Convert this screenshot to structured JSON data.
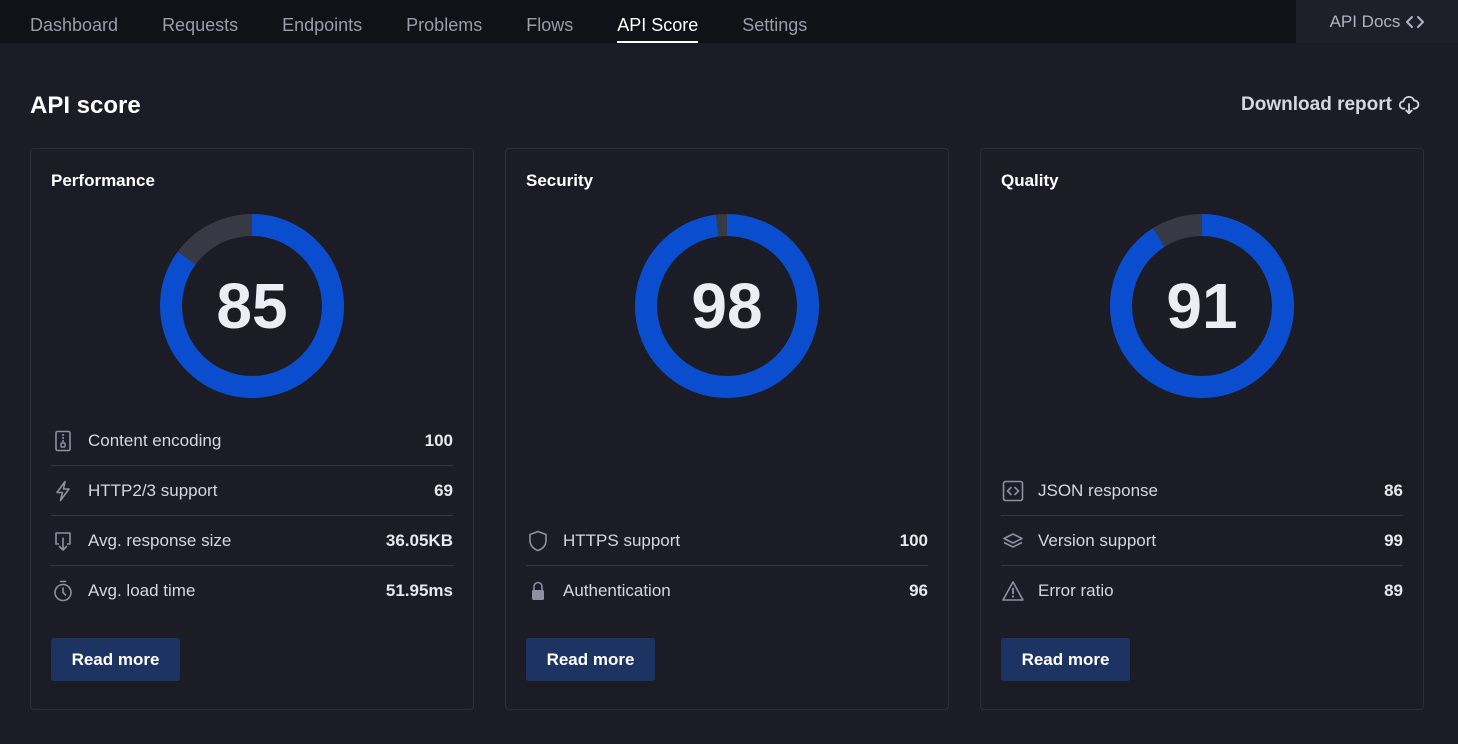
{
  "nav": {
    "tabs": [
      {
        "label": "Dashboard",
        "active": false
      },
      {
        "label": "Requests",
        "active": false
      },
      {
        "label": "Endpoints",
        "active": false
      },
      {
        "label": "Problems",
        "active": false
      },
      {
        "label": "Flows",
        "active": false
      },
      {
        "label": "API Score",
        "active": true
      },
      {
        "label": "Settings",
        "active": false
      }
    ],
    "api_docs_label": "API Docs"
  },
  "header": {
    "title": "API score",
    "download_label": "Download report"
  },
  "colors": {
    "gauge_fill": "#0a4ecf",
    "gauge_track": "#373945",
    "button": "#1d3462"
  },
  "cards": [
    {
      "title": "Performance",
      "score": 85,
      "score_text": "85",
      "metrics": [
        {
          "icon": "zip-file-icon",
          "label": "Content encoding",
          "value": "100"
        },
        {
          "icon": "lightning-icon",
          "label": "HTTP2/3 support",
          "value": "69"
        },
        {
          "icon": "download-arrow-icon",
          "label": "Avg. response size",
          "value": "36.05KB"
        },
        {
          "icon": "stopwatch-icon",
          "label": "Avg. load time",
          "value": "51.95ms"
        }
      ],
      "button_label": "Read more"
    },
    {
      "title": "Security",
      "score": 98,
      "score_text": "98",
      "metrics": [
        {
          "icon": "shield-icon",
          "label": "HTTPS support",
          "value": "100"
        },
        {
          "icon": "lock-icon",
          "label": "Authentication",
          "value": "96"
        }
      ],
      "button_label": "Read more"
    },
    {
      "title": "Quality",
      "score": 91,
      "score_text": "91",
      "metrics": [
        {
          "icon": "code-box-icon",
          "label": "JSON response",
          "value": "86"
        },
        {
          "icon": "layers-icon",
          "label": "Version support",
          "value": "99"
        },
        {
          "icon": "warning-icon",
          "label": "Error ratio",
          "value": "89"
        }
      ],
      "button_label": "Read more"
    }
  ]
}
